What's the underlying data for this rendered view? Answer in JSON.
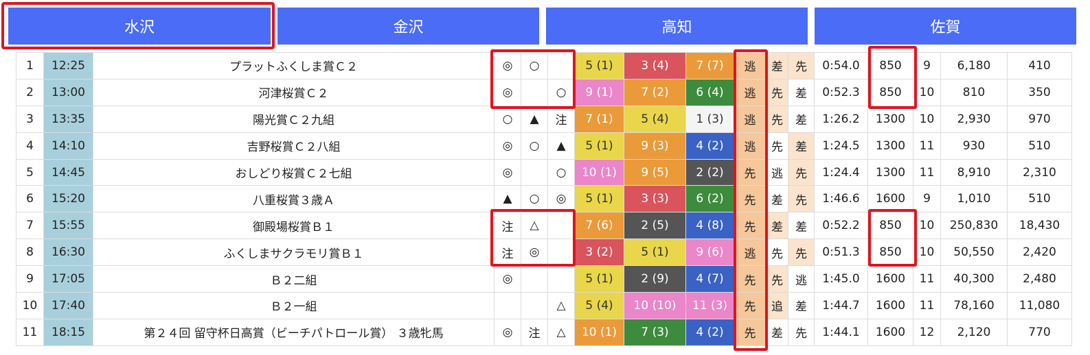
{
  "venue_tabs": [
    "水沢",
    "金沢",
    "高知",
    "佐賀"
  ],
  "selected_tab": "水沢",
  "colors": {
    "tab_bg": "#4a6cf7",
    "highlight": "#e0141e",
    "time_bg": "#a8d0dc",
    "runstyle_main_bg": "#f6c79a",
    "runstyle_sub_bg": "#fbe3cc",
    "horse_number_colors": {
      "1": "#f4f4f4",
      "2": "#555555",
      "3": "#d9545c",
      "4": "#3a62c4",
      "5": "#e9d64a",
      "6": "#3d8b3d",
      "7": "#eb9a3a",
      "8": "#ea86c9",
      "9": "#ea86c9",
      "10": "#eb9a3a",
      "11": "#ea86c9"
    }
  },
  "races": [
    {
      "no": "1",
      "time": "12:25",
      "name": "プラットふくしま賞Ｃ２",
      "m1": "◎",
      "m2": "○",
      "m3": "",
      "p1": "5 (1)",
      "p1c": "#e9d64a",
      "p2": "3 (4)",
      "p2c": "#d9545c",
      "p3": "7 (7)",
      "p3c": "#eb9a3a",
      "rs1": "逃",
      "rs2": "差",
      "rs3": "先",
      "rs2h": true,
      "rs3h": true,
      "result_time": "0:54.0",
      "distance": "850",
      "field": "9",
      "payout1": "6,180",
      "payout2": "410"
    },
    {
      "no": "2",
      "time": "13:00",
      "name": "河津桜賞Ｃ２",
      "m1": "◎",
      "m2": "",
      "m3": "○",
      "p1": "9 (1)",
      "p1c": "#ea86c9",
      "p2": "7 (2)",
      "p2c": "#eb9a3a",
      "p3": "6 (4)",
      "p3c": "#3d8b3d",
      "rs1": "逃",
      "rs2": "先",
      "rs3": "差",
      "rs2h": true,
      "rs3h": false,
      "result_time": "0:52.3",
      "distance": "850",
      "field": "10",
      "payout1": "810",
      "payout2": "350"
    },
    {
      "no": "3",
      "time": "13:35",
      "name": "陽光賞Ｃ２九組",
      "m1": "○",
      "m2": "▲",
      "m3": "注",
      "p1": "7 (1)",
      "p1c": "#eb9a3a",
      "p2": "5 (4)",
      "p2c": "#e9d64a",
      "p3": "1 (3)",
      "p3c": "#f4f4f4",
      "rs1": "逃",
      "rs2": "先",
      "rs3": "差",
      "rs2h": true,
      "rs3h": false,
      "result_time": "1:26.2",
      "distance": "1300",
      "field": "10",
      "payout1": "2,930",
      "payout2": "970"
    },
    {
      "no": "4",
      "time": "14:10",
      "name": "吉野桜賞Ｃ２八組",
      "m1": "◎",
      "m2": "○",
      "m3": "▲",
      "p1": "5 (1)",
      "p1c": "#e9d64a",
      "p2": "9 (3)",
      "p2c": "#eb9a3a",
      "p3": "4 (2)",
      "p3c": "#3a62c4",
      "rs1": "逃",
      "rs2": "先",
      "rs3": "差",
      "rs2h": false,
      "rs3h": true,
      "result_time": "1:24.5",
      "distance": "1300",
      "field": "11",
      "payout1": "930",
      "payout2": "510"
    },
    {
      "no": "5",
      "time": "14:45",
      "name": "おしどり桜賞Ｃ２七組",
      "m1": "◎",
      "m2": "",
      "m3": "○",
      "p1": "10 (1)",
      "p1c": "#ea86c9",
      "p2": "9 (5)",
      "p2c": "#eb9a3a",
      "p3": "2 (2)",
      "p3c": "#555555",
      "rs1": "先",
      "rs2": "逃",
      "rs3": "先",
      "rs2h": false,
      "rs3h": true,
      "result_time": "1:24.4",
      "distance": "1300",
      "field": "11",
      "payout1": "8,910",
      "payout2": "2,310"
    },
    {
      "no": "6",
      "time": "15:20",
      "name": "八重桜賞３歳Ａ",
      "m1": "▲",
      "m2": "○",
      "m3": "◎",
      "p1": "5 (1)",
      "p1c": "#e9d64a",
      "p2": "3 (3)",
      "p2c": "#d9545c",
      "p3": "6 (2)",
      "p3c": "#3d8b3d",
      "rs1": "先",
      "rs2": "差",
      "rs3": "先",
      "rs2h": false,
      "rs3h": true,
      "result_time": "1:46.6",
      "distance": "1600",
      "field": "9",
      "payout1": "1,010",
      "payout2": "510"
    },
    {
      "no": "7",
      "time": "15:55",
      "name": "御殿場桜賞Ｂ１",
      "m1": "注",
      "m2": "△",
      "m3": "",
      "p1": "7 (6)",
      "p1c": "#eb9a3a",
      "p2": "2 (5)",
      "p2c": "#555555",
      "p3": "4 (8)",
      "p3c": "#3a62c4",
      "rs1": "先",
      "rs2": "差",
      "rs3": "差",
      "rs2h": true,
      "rs3h": false,
      "result_time": "0:52.2",
      "distance": "850",
      "field": "10",
      "payout1": "250,830",
      "payout2": "18,430"
    },
    {
      "no": "8",
      "time": "16:30",
      "name": "ふくしまサクラモリ賞Ｂ１",
      "m1": "注",
      "m2": "◎",
      "m3": "",
      "p1": "3 (2)",
      "p1c": "#d9545c",
      "p2": "5 (1)",
      "p2c": "#e9d64a",
      "p3": "9 (6)",
      "p3c": "#ea86c9",
      "rs1": "逃",
      "rs2": "先",
      "rs3": "先",
      "rs2h": false,
      "rs3h": true,
      "result_time": "0:51.3",
      "distance": "850",
      "field": "10",
      "payout1": "50,550",
      "payout2": "2,420"
    },
    {
      "no": "9",
      "time": "17:05",
      "name": "Ｂ２二組",
      "m1": "◎",
      "m2": "",
      "m3": "",
      "p1": "5 (1)",
      "p1c": "#e9d64a",
      "p2": "2 (9)",
      "p2c": "#555555",
      "p3": "4 (7)",
      "p3c": "#3a62c4",
      "rs1": "先",
      "rs2": "先",
      "rs3": "逃",
      "rs2h": true,
      "rs3h": false,
      "result_time": "1:45.0",
      "distance": "1600",
      "field": "11",
      "payout1": "40,300",
      "payout2": "2,480"
    },
    {
      "no": "10",
      "time": "17:40",
      "name": "Ｂ２一組",
      "m1": "",
      "m2": "",
      "m3": "△",
      "p1": "5 (4)",
      "p1c": "#e9d64a",
      "p2": "10 (10)",
      "p2c": "#ea86c9",
      "p3": "11 (3)",
      "p3c": "#ea86c9",
      "rs1": "先",
      "rs2": "追",
      "rs3": "差",
      "rs2h": true,
      "rs3h": false,
      "result_time": "1:44.7",
      "distance": "1600",
      "field": "11",
      "payout1": "78,160",
      "payout2": "11,080"
    },
    {
      "no": "11",
      "time": "18:15",
      "name": "第２４回 留守杯日高賞（ビーチパトロール賞） ３歳牝馬",
      "m1": "◎",
      "m2": "注",
      "m3": "△",
      "p1": "10 (1)",
      "p1c": "#eb9a3a",
      "p2": "7 (3)",
      "p2c": "#3d8b3d",
      "p3": "4 (2)",
      "p3c": "#3a62c4",
      "rs1": "先",
      "rs2": "差",
      "rs3": "先",
      "rs2h": false,
      "rs3h": false,
      "result_time": "1:44.1",
      "distance": "1600",
      "field": "12",
      "payout1": "2,120",
      "payout2": "770"
    }
  ]
}
